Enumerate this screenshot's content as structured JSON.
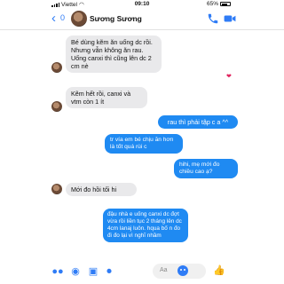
{
  "status": {
    "carrier": "Viettel",
    "time": "09:10",
    "battery": "65%"
  },
  "header": {
    "back_glyph": "‹",
    "unread_count": "0",
    "contact_name": "Sương Sương"
  },
  "messages": [
    {
      "side": "received",
      "text": "Bé dùng kẽm ăn uống dc rồi. Nhưng vẫn không ăn rau. Uống canxi thì cũng lên dc 2 cm nè"
    },
    {
      "side": "received",
      "text": "Kẽm hết rồi, canxi và vtm còn 1 ít"
    },
    {
      "side": "sent",
      "text": "rau thì phải tập c a ^^"
    },
    {
      "side": "sent",
      "text": "tr vía em bé chịu ăn hơn là tốt quá rùi c"
    },
    {
      "side": "sent",
      "text": "hihi, mẹ mới đo chiều cao ạ?"
    },
    {
      "side": "received",
      "text": "Mới đo hồi tối hi"
    },
    {
      "side": "sent",
      "text": "đậu nhà e uống canxi dc đợt vừa rồi liền tục 2 tháng lên dc 4cm lanaj luôn. hqua bố n đo đi đo lại vì nghĩ nhầm"
    }
  ],
  "reaction": "❤",
  "composer": {
    "placeholder": "Aa",
    "like_icon": "thumbs-up-icon"
  },
  "colors": {
    "accent": "#2f7cf6",
    "sent_bubble": "#1f8af2",
    "received_bubble": "#e9e9eb"
  }
}
